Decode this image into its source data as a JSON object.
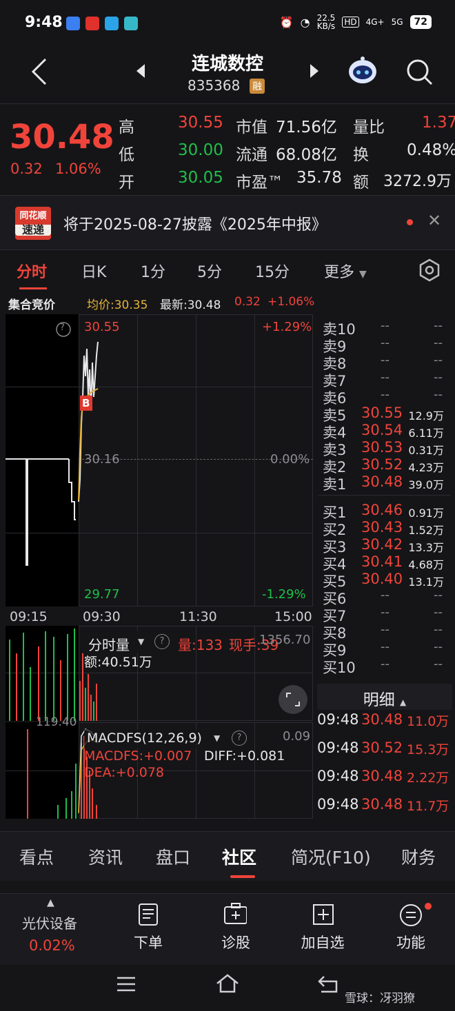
{
  "status_bar": {
    "time": "9:48",
    "speed": "22.5",
    "speed_unit": "KB/s",
    "hd_label": "HD",
    "net1": "4G+",
    "net2": "5G",
    "battery": "72"
  },
  "nav": {
    "title": "连城数控",
    "code": "835368",
    "badge": "融"
  },
  "quote": {
    "last": "30.48",
    "change": "0.32",
    "change_pct": "1.06%",
    "high_label": "高",
    "high": "30.55",
    "low_label": "低",
    "low": "30.00",
    "open_label": "开",
    "open": "30.05",
    "mcap_label": "市值",
    "mcap": "71.56亿",
    "float_label": "流通",
    "float": "68.08亿",
    "pe_label": "市盈™",
    "pe": "35.78",
    "vr_label": "量比",
    "vr": "1.37",
    "turnover_label": "换",
    "turnover": "0.48%",
    "amount_label": "额",
    "amount": "3272.9万"
  },
  "notice": {
    "logo_top": "同花顺",
    "logo_bottom": "速递",
    "text": "将于2025-08-27披露《2025年中报》"
  },
  "period_tabs": [
    "分时",
    "日K",
    "1分",
    "5分",
    "15分",
    "更多"
  ],
  "info_line": {
    "label": "集合竞价",
    "avg": "均价:30.35",
    "latest": "最新:30.48",
    "chg": "0.32",
    "pct": "+1.06%"
  },
  "chart": {
    "top_price": "30.55",
    "mid_price": "30.16",
    "bottom_price": "29.77",
    "top_pct": "+1.29%",
    "mid_pct": "0.00%",
    "bottom_pct": "-1.29%",
    "b_marker": "B",
    "help": "?",
    "times": [
      "09:15",
      "09:30",
      "11:30",
      "15:00"
    ]
  },
  "volume_panel": {
    "selector": "分时量",
    "vol": "量:133",
    "hand": "现手:39",
    "max": "1356.70",
    "amount": "额:40.51万",
    "left_val": "119.40"
  },
  "macd_panel": {
    "selector": "MACDFS(12,26,9)",
    "max": "0.09",
    "macd": "MACDFS:+0.007",
    "diff": "DIFF:+0.081",
    "dea": "DEA:+0.078"
  },
  "order_book": {
    "sells": [
      {
        "label": "卖10",
        "price": "--",
        "vol": "--"
      },
      {
        "label": "卖9",
        "price": "--",
        "vol": "--"
      },
      {
        "label": "卖8",
        "price": "--",
        "vol": "--"
      },
      {
        "label": "卖7",
        "price": "--",
        "vol": "--"
      },
      {
        "label": "卖6",
        "price": "--",
        "vol": "--"
      },
      {
        "label": "卖5",
        "price": "30.55",
        "vol": "12.9万"
      },
      {
        "label": "卖4",
        "price": "30.54",
        "vol": "6.11万"
      },
      {
        "label": "卖3",
        "price": "30.53",
        "vol": "0.31万"
      },
      {
        "label": "卖2",
        "price": "30.52",
        "vol": "4.23万"
      },
      {
        "label": "卖1",
        "price": "30.48",
        "vol": "39.0万"
      }
    ],
    "buys": [
      {
        "label": "买1",
        "price": "30.46",
        "vol": "0.91万"
      },
      {
        "label": "买2",
        "price": "30.43",
        "vol": "1.52万"
      },
      {
        "label": "买3",
        "price": "30.42",
        "vol": "13.3万"
      },
      {
        "label": "买4",
        "price": "30.41",
        "vol": "4.68万"
      },
      {
        "label": "买5",
        "price": "30.40",
        "vol": "13.1万"
      },
      {
        "label": "买6",
        "price": "--",
        "vol": "--"
      },
      {
        "label": "买7",
        "price": "--",
        "vol": "--"
      },
      {
        "label": "买8",
        "price": "--",
        "vol": "--"
      },
      {
        "label": "买9",
        "price": "--",
        "vol": "--"
      },
      {
        "label": "买10",
        "price": "--",
        "vol": "--"
      }
    ]
  },
  "detail": {
    "header": "明细",
    "trades": [
      {
        "time": "09:48",
        "price": "30.48",
        "vol": "11.0万"
      },
      {
        "time": "09:48",
        "price": "30.52",
        "vol": "15.3万"
      },
      {
        "time": "09:48",
        "price": "30.48",
        "vol": "2.22万"
      },
      {
        "time": "09:48",
        "price": "30.48",
        "vol": "11.7万"
      }
    ]
  },
  "bottom_tabs": [
    "看点",
    "资讯",
    "盘口",
    "社区",
    "简况(F10)",
    "财务"
  ],
  "action_bar": {
    "sector": "光伏设备",
    "sector_pct": "0.02%",
    "order": "下单",
    "diagnose": "诊股",
    "add_watch": "加自选",
    "functions": "功能"
  },
  "watermark": "雪球：冴羽獠",
  "colors": {
    "up": "#f0443a",
    "down": "#1fbf4a",
    "avg_line": "#e6b23a",
    "background": "#151518"
  }
}
